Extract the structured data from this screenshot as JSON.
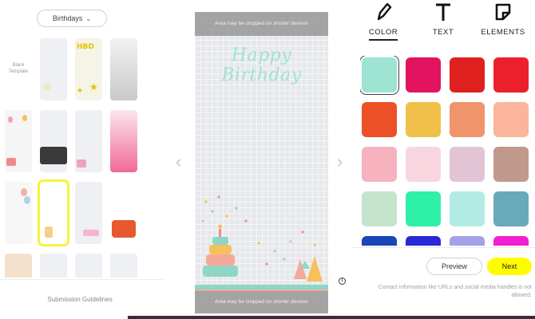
{
  "filter": {
    "label": "Birthdays"
  },
  "templates": {
    "blank_label": "Blank Template",
    "guidelines_label": "Submission Guidelines"
  },
  "preview": {
    "crop_notice_top": "Area may be cropped on shorter devices",
    "crop_notice_bottom": "Area may be cropped on shorter devices",
    "heading_text": "Happy Birthday"
  },
  "tools": {
    "color_label": "COLOR",
    "text_label": "TEXT",
    "elements_label": "ELEMENTS",
    "active": "color",
    "color_icon": "pencil-icon",
    "text_icon": "text-t-icon",
    "elements_icon": "sticker-icon"
  },
  "colors": {
    "selected": "#9fe3d3",
    "swatches": [
      "#9fe3d3",
      "#e2145f",
      "#e0201e",
      "#ec1f2d",
      "#ec5027",
      "#f0c04a",
      "#f0946b",
      "#fbb59a",
      "#f6b2bf",
      "#f8d6e0",
      "#e3c4d4",
      "#c1998c",
      "#c6e3cc",
      "#2ef0a8",
      "#b2ebe3",
      "#6aa9ba",
      "#1b46b5",
      "#2a28d6",
      "#a3a1e8",
      "#f21fd0"
    ]
  },
  "actions": {
    "preview_label": "Preview",
    "next_label": "Next"
  },
  "notice": {
    "text": "Contact information like URLs and social media handles is not allowed."
  }
}
